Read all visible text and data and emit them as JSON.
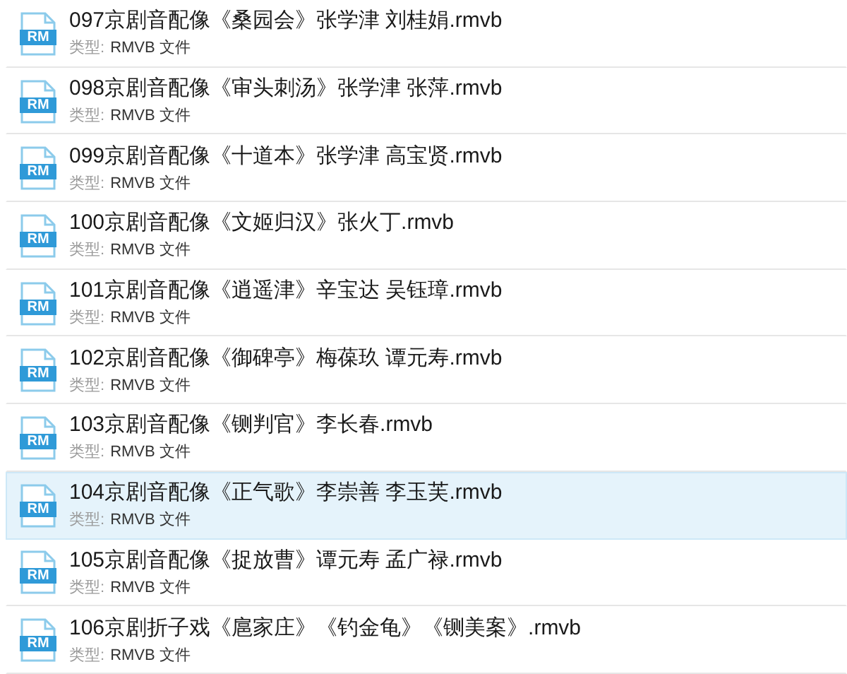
{
  "files": [
    {
      "icon_text": "RM",
      "name": "097京剧音配像《桑园会》张学津 刘桂娟.rmvb",
      "type_label": "类型:",
      "type": "RMVB 文件",
      "selected": false
    },
    {
      "icon_text": "RM",
      "name": "098京剧音配像《审头刺汤》张学津 张萍.rmvb",
      "type_label": "类型:",
      "type": "RMVB 文件",
      "selected": false
    },
    {
      "icon_text": "RM",
      "name": "099京剧音配像《十道本》张学津 高宝贤.rmvb",
      "type_label": "类型:",
      "type": "RMVB 文件",
      "selected": false
    },
    {
      "icon_text": "RM",
      "name": "100京剧音配像《文姬归汉》张火丁.rmvb",
      "type_label": "类型:",
      "type": "RMVB 文件",
      "selected": false
    },
    {
      "icon_text": "RM",
      "name": "101京剧音配像《逍遥津》辛宝达 吴钰璋.rmvb",
      "type_label": "类型:",
      "type": "RMVB 文件",
      "selected": false
    },
    {
      "icon_text": "RM",
      "name": "102京剧音配像《御碑亭》梅葆玖 谭元寿.rmvb",
      "type_label": "类型:",
      "type": "RMVB 文件",
      "selected": false
    },
    {
      "icon_text": "RM",
      "name": "103京剧音配像《铡判官》李长春.rmvb",
      "type_label": "类型:",
      "type": "RMVB 文件",
      "selected": false
    },
    {
      "icon_text": "RM",
      "name": "104京剧音配像《正气歌》李崇善 李玉芙.rmvb",
      "type_label": "类型:",
      "type": "RMVB 文件",
      "selected": true
    },
    {
      "icon_text": "RM",
      "name": "105京剧音配像《捉放曹》谭元寿 孟广禄.rmvb",
      "type_label": "类型:",
      "type": "RMVB 文件",
      "selected": false
    },
    {
      "icon_text": "RM",
      "name": "106京剧折子戏《扈家庄》《钓金龟》《铡美案》.rmvb",
      "type_label": "类型:",
      "type": "RMVB 文件",
      "selected": false
    }
  ]
}
